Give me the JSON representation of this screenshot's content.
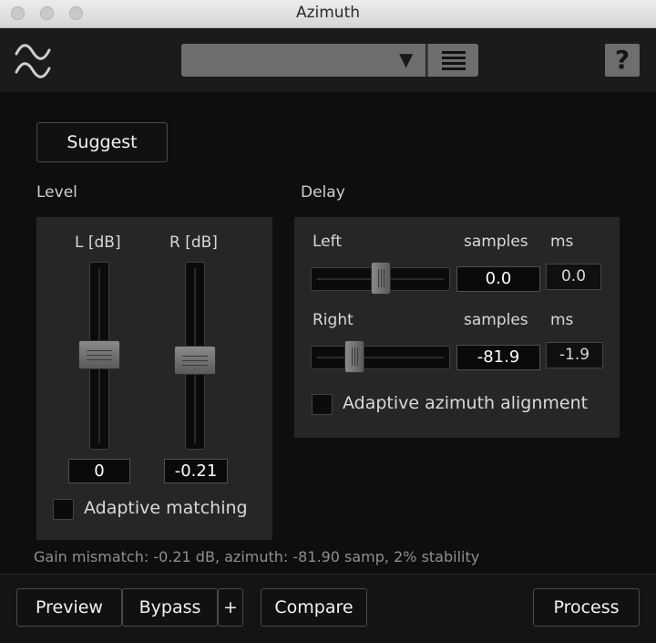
{
  "window": {
    "title": "Azimuth"
  },
  "header": {
    "logo_icon": "waveform-icon",
    "preset": {
      "selected": "",
      "arrow_icon": "triangle-down-icon",
      "menu_icon": "hamburger-menu-icon"
    },
    "help_label": "?"
  },
  "main": {
    "suggest_label": "Suggest",
    "level": {
      "title": "Level",
      "left_header": "L [dB]",
      "right_header": "R [dB]",
      "left_value": "0",
      "right_value": "-0.21",
      "adaptive_label": "Adaptive matching",
      "adaptive_checked": false
    },
    "delay": {
      "title": "Delay",
      "samples_header": "samples",
      "ms_header": "ms",
      "rows": [
        {
          "label": "Left",
          "samples": "0.0",
          "ms": "0.0"
        },
        {
          "label": "Right",
          "samples": "-81.9",
          "ms": "-1.9"
        }
      ],
      "adaptive_label": "Adaptive azimuth alignment",
      "adaptive_checked": false
    },
    "status": "Gain mismatch: -0.21 dB, azimuth: -81.90 samp, 2% stability"
  },
  "footer": {
    "preview_label": "Preview",
    "bypass_label": "Bypass",
    "plus_label": "+",
    "compare_label": "Compare",
    "process_label": "Process"
  },
  "colors": {
    "background": "#0d0d0d",
    "panel": "#262626",
    "header": "#1b1b1b",
    "control_grey": "#6e6e6e"
  }
}
